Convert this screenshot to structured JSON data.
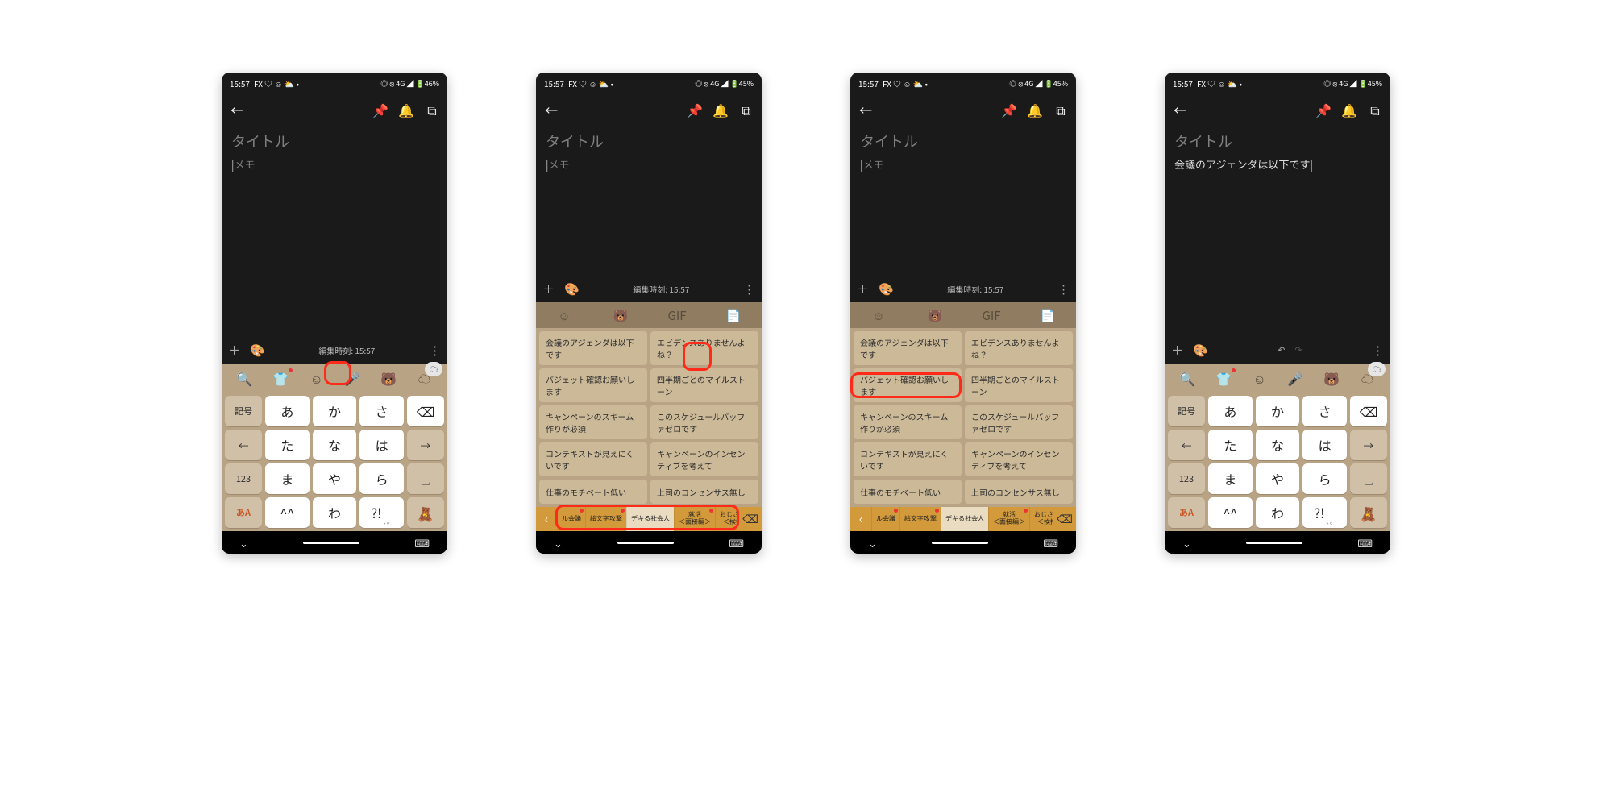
{
  "status": {
    "time": "15:57",
    "left_icons": "FX ♡ ☺ ⛅ •",
    "right_a": "◎ ⦻ 4G ◢ 🔋46%",
    "right_b": "◎ ⦻ 4G ◢ 🔋45%"
  },
  "appbar": {
    "back": "←",
    "pin": "📌",
    "bell": "🔔",
    "archive": "⧉"
  },
  "note": {
    "title_placeholder": "タイトル",
    "body_placeholder": "メモ",
    "body_text_4": "会議のアジェンダは以下です",
    "edit_time": "編集時刻: 15:57",
    "add": "＋",
    "palette": "🎨",
    "more": "⋮",
    "undo": "↶",
    "redo": "↷"
  },
  "emoji_row": {
    "slots": [
      "🔍",
      "👕",
      "☺",
      "🎤",
      "🐻",
      "☁"
    ],
    "bubble": "☁"
  },
  "tabs_row": [
    "☺",
    "🐻",
    "GIF",
    "📄"
  ],
  "kana": {
    "side_left": [
      "記号",
      "←",
      "123",
      "あA"
    ],
    "side_right": [
      "⌫",
      "→",
      "␣",
      "🧸"
    ],
    "rows": [
      [
        "あ",
        "か",
        "さ"
      ],
      [
        "た",
        "な",
        "は"
      ],
      [
        "ま",
        "や",
        "ら"
      ],
      [
        "^^",
        "わ",
        "?!"
      ]
    ],
    "delete_label": "⌫",
    "space_face": "^^",
    "punct_small": "、。"
  },
  "phrases": [
    [
      "会議のアジェンダは以下です",
      "エビデンスありませんよね？"
    ],
    [
      "バジェット確認お願いします",
      "四半期ごとのマイルストーン"
    ],
    [
      "キャンペーンのスキーム作りが必須",
      "このスケジュールバッファゼロです"
    ],
    [
      "コンテキストが見えにくいです",
      "キャンペーンのインセンティブを考えて"
    ],
    [
      "仕事のモチベート低い",
      "上司のコンセンサス無し"
    ]
  ],
  "categories": {
    "items": [
      {
        "label": "ル会議",
        "dot": true
      },
      {
        "label": "絵文字攻撃",
        "dot": true
      },
      {
        "label": "デキる社会人",
        "selected": true
      },
      {
        "label": "就活",
        "sub": "＜面接編＞",
        "dot": true
      },
      {
        "label": "おじさん会",
        "sub": "＜挨拶＞",
        "dot": true
      }
    ],
    "left_arrow": "‹",
    "delete": "⌫"
  },
  "nav": {
    "down": "⌄",
    "kb": "⌨"
  }
}
